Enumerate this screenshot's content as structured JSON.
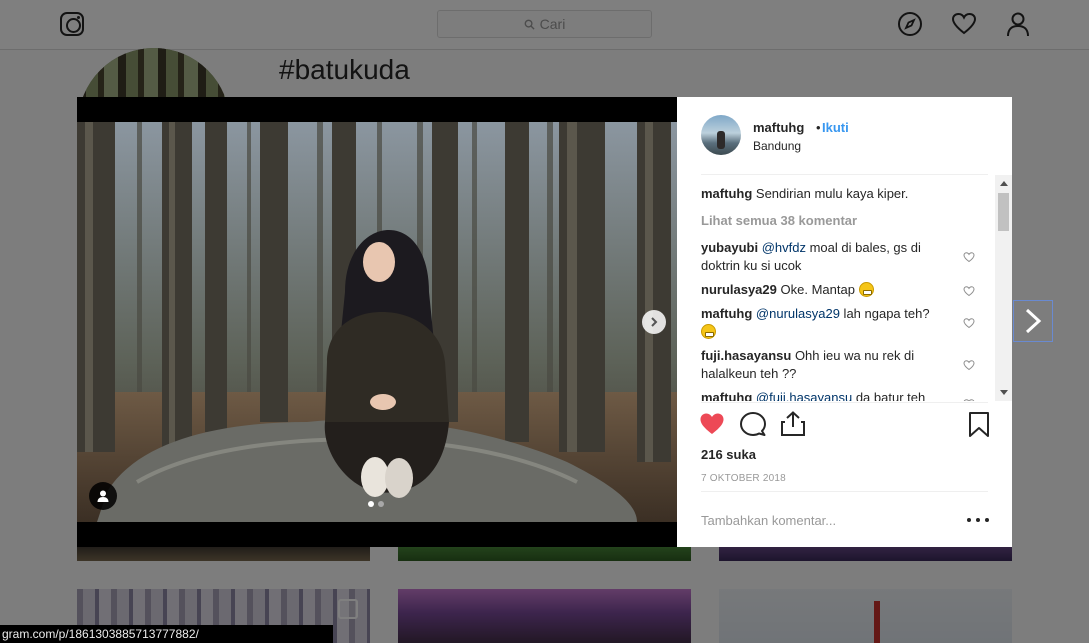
{
  "topbar": {
    "search_placeholder": "Cari"
  },
  "page": {
    "hashtag": "#batukuda"
  },
  "status_bar_url": "gram.com/p/1861303885713777882/",
  "post": {
    "username": "maftuhg",
    "bullet": "•",
    "follow_label": "Ikuti",
    "location": "Bandung",
    "carousel": {
      "current": 1,
      "total": 2
    },
    "caption": {
      "user": "maftuhg",
      "text": "Sendirian mulu kaya kiper."
    },
    "view_all_comments": "Lihat semua 38 komentar",
    "comments": [
      {
        "user": "yubayubi",
        "mention": "@hvfdz",
        "text": " moal di bales, gs di doktrin ku si ucok"
      },
      {
        "user": "nurulasya29",
        "mention": "",
        "text": "Oke. Mantap",
        "emoji": "grinning-face"
      },
      {
        "user": "maftuhg",
        "mention": "@nurulasya29",
        "text": " lah ngapa teh?",
        "emoji": "grinning-face"
      },
      {
        "user": "fuji.hasayansu",
        "mention": "",
        "text": "Ohh ieu wa nu rek di halalkeun teh ??"
      },
      {
        "user": "maftuhg",
        "mention": "@fuji.hasayansu",
        "text": " da batur teh"
      }
    ],
    "likes": "216 suka",
    "date": "7 OKTOBER 2018",
    "add_comment_placeholder": "Tambahkan komentar...",
    "liked": true,
    "like_color": "#ed4956"
  },
  "colors": {
    "link": "#3897f0",
    "mention": "#003569",
    "muted": "#999999"
  }
}
